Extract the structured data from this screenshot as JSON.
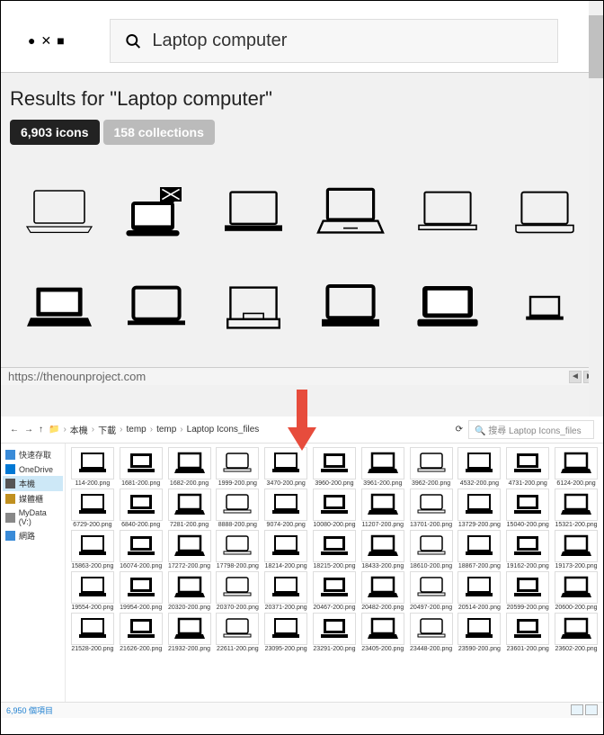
{
  "search": {
    "query": "Laptop computer"
  },
  "results": {
    "title": "Results for \"Laptop computer\"",
    "tabs": {
      "icons": "6,903 icons",
      "collections": "158 collections"
    }
  },
  "url": "https://thenounproject.com",
  "explorer": {
    "breadcrumb": [
      "本機",
      "下載",
      "temp",
      "temp",
      "Laptop Icons_files"
    ],
    "search_placeholder": "搜尋 Laptop Icons_files",
    "sidebar": [
      {
        "label": "快速存取",
        "color": "#3a8bd8"
      },
      {
        "label": "OneDrive",
        "color": "#0078d4"
      },
      {
        "label": "本機",
        "color": "#555",
        "active": true
      },
      {
        "label": "媒體櫃",
        "color": "#c09020"
      },
      {
        "label": "MyData (V:)",
        "color": "#888"
      },
      {
        "label": "網路",
        "color": "#3a8bd8"
      }
    ],
    "files": [
      [
        "114-200.png",
        "1681-200.png",
        "1682-200.png",
        "1999-200.png",
        "3470-200.png",
        "3960-200.png",
        "3961-200.png",
        "3962-200.png",
        "4532-200.png",
        "4731-200.png",
        "6124-200.png"
      ],
      [
        "6729-200.png",
        "6840-200.png",
        "7281-200.png",
        "8888-200.png",
        "9074-200.png",
        "10080-200.png",
        "11207-200.png",
        "13701-200.png",
        "13729-200.png",
        "15040-200.png",
        "15321-200.png"
      ],
      [
        "15863-200.png",
        "16074-200.png",
        "17272-200.png",
        "17798-200.png",
        "18214-200.png",
        "18215-200.png",
        "18433-200.png",
        "18610-200.png",
        "18867-200.png",
        "19162-200.png",
        "19173-200.png"
      ],
      [
        "19554-200.png",
        "19954-200.png",
        "20320-200.png",
        "20370-200.png",
        "20371-200.png",
        "20467-200.png",
        "20482-200.png",
        "20497-200.png",
        "20514-200.png",
        "20599-200.png",
        "20600-200.png"
      ],
      [
        "21528-200.png",
        "21626-200.png",
        "21932-200.png",
        "22611-200.png",
        "23095-200.png",
        "23291-200.png",
        "23405-200.png",
        "23448-200.png",
        "23590-200.png",
        "23601-200.png",
        "23602-200.png"
      ]
    ],
    "status": "6,950 個項目"
  }
}
